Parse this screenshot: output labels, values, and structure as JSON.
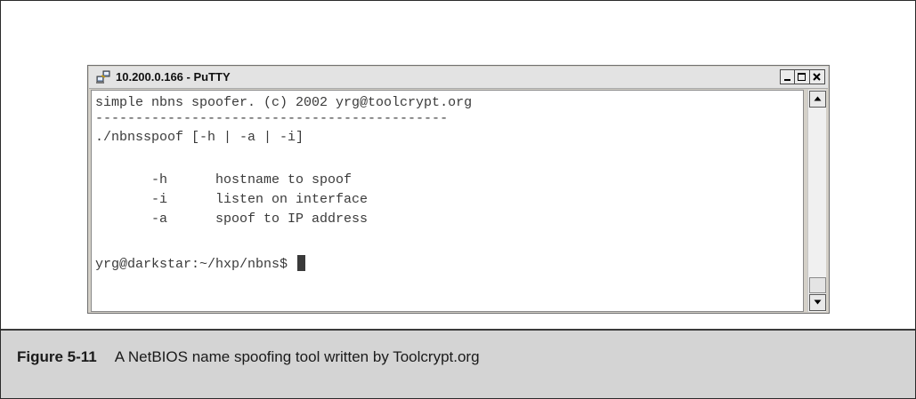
{
  "window": {
    "title": "10.200.0.166 - PuTTY",
    "icon": "putty-network-icon"
  },
  "terminal": {
    "lines": [
      "simple nbns spoofer. (c) 2002 yrg@toolcrypt.org",
      "--------------------------------------------",
      "./nbnsspoof [-h | -a | -i]",
      "",
      "       -h      hostname to spoof",
      "       -i      listen on interface",
      "       -a      spoof to IP address",
      "",
      "yrg@darkstar:~/hxp/nbns$ "
    ]
  },
  "caption": {
    "label": "Figure 5-11",
    "text": "A NetBIOS name spoofing tool written by Toolcrypt.org"
  }
}
